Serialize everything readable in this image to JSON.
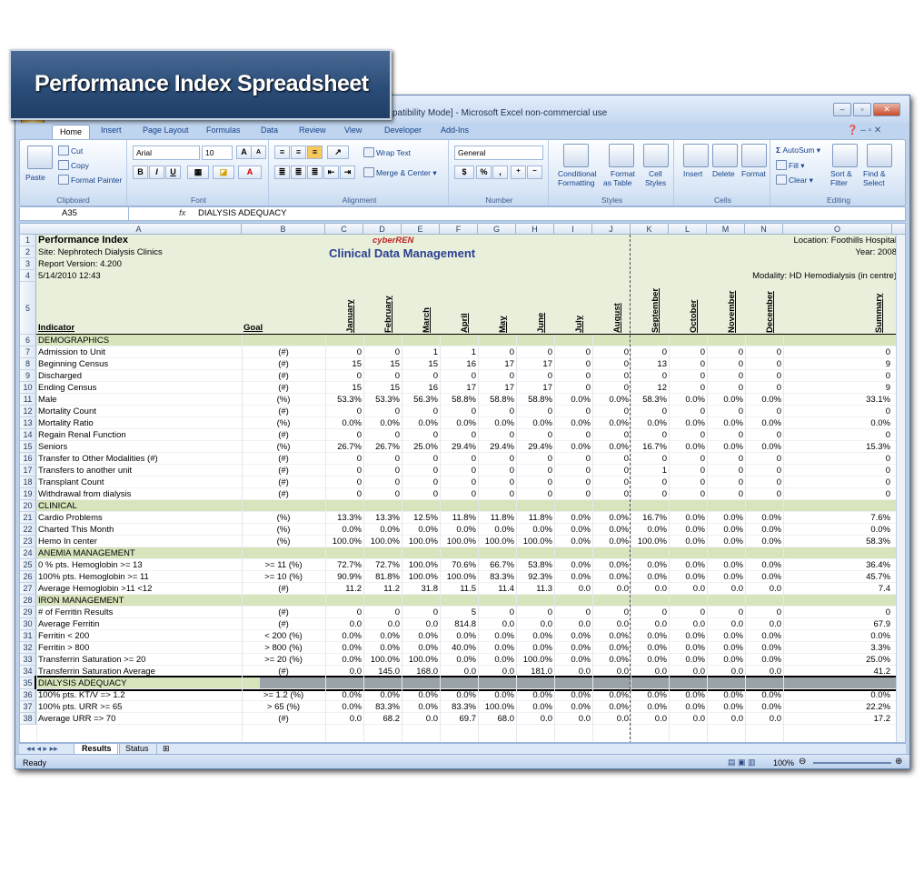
{
  "banner": {
    "title": "Performance Index Spreadsheet"
  },
  "window": {
    "title": "patibility Mode] - Microsoft Excel non-commercial use"
  },
  "tabs": [
    "Home",
    "Insert",
    "Page Layout",
    "Formulas",
    "Data",
    "Review",
    "View",
    "Developer",
    "Add-Ins"
  ],
  "ribbon": {
    "clipboard": {
      "paste": "Paste",
      "cut": "Cut",
      "copy": "Copy",
      "format_painter": "Format Painter",
      "label": "Clipboard"
    },
    "font": {
      "name": "Arial",
      "size": "10",
      "label": "Font",
      "bold": "B",
      "italic": "I",
      "underline": "U",
      "grow": "A",
      "shrink": "A"
    },
    "alignment": {
      "wrap": "Wrap Text",
      "merge": "Merge & Center",
      "label": "Alignment"
    },
    "number": {
      "format": "General",
      "currency": "$",
      "percent": "%",
      "comma": ",",
      "label": "Number"
    },
    "styles": {
      "cond": "Conditional",
      "cond2": "Formatting",
      "fmt_table": "Format",
      "fmt_table2": "as Table",
      "cell_styles": "Cell",
      "cell_styles2": "Styles",
      "label": "Styles"
    },
    "cells": {
      "insert": "Insert",
      "delete": "Delete",
      "format": "Format",
      "label": "Cells"
    },
    "editing": {
      "autosum": "AutoSum",
      "fill": "Fill",
      "clear": "Clear",
      "sort": "Sort &",
      "sort2": "Filter",
      "find": "Find &",
      "find2": "Select",
      "label": "Editing"
    }
  },
  "formula_bar": {
    "name_box": "A35",
    "fx": "fx",
    "content": "DIALYSIS ADEQUACY"
  },
  "columns": [
    "A",
    "B",
    "C",
    "D",
    "E",
    "F",
    "G",
    "H",
    "I",
    "J",
    "K",
    "L",
    "M",
    "N",
    "O"
  ],
  "header": {
    "title": "Performance Index",
    "site": "Site: Nephrotech Dialysis Clinics",
    "version": "Report Version: 4.200",
    "date": "5/14/2010 12:43",
    "logo": "cyberREN",
    "app_title": "Clinical Data Management",
    "location": "Location:  Foothills Hospital",
    "year": "Year:  2008",
    "modality": "Modality:  HD Hemodialysis (in centre)",
    "indicator": "Indicator",
    "goal": "Goal",
    "months": [
      "January",
      "February",
      "March",
      "April",
      "May",
      "June",
      "July",
      "August",
      "September",
      "October",
      "November",
      "December",
      "Summary"
    ]
  },
  "rows": [
    {
      "n": "6",
      "label": "DEMOGRAPHICS",
      "section": true
    },
    {
      "n": "7",
      "label": "Admission to Unit",
      "goal": "(#)",
      "v": [
        "0",
        "0",
        "1",
        "1",
        "0",
        "0",
        "0",
        "0",
        "0",
        "0",
        "0",
        "0",
        "0"
      ]
    },
    {
      "n": "8",
      "label": "Beginning Census",
      "goal": "(#)",
      "v": [
        "15",
        "15",
        "15",
        "16",
        "17",
        "17",
        "0",
        "0",
        "13",
        "0",
        "0",
        "0",
        "9"
      ]
    },
    {
      "n": "9",
      "label": "Discharged",
      "goal": "(#)",
      "v": [
        "0",
        "0",
        "0",
        "0",
        "0",
        "0",
        "0",
        "0",
        "0",
        "0",
        "0",
        "0",
        "0"
      ]
    },
    {
      "n": "10",
      "label": "Ending Census",
      "goal": "(#)",
      "v": [
        "15",
        "15",
        "16",
        "17",
        "17",
        "17",
        "0",
        "0",
        "12",
        "0",
        "0",
        "0",
        "9"
      ]
    },
    {
      "n": "11",
      "label": "Male",
      "goal": "(%)",
      "v": [
        "53.3%",
        "53.3%",
        "56.3%",
        "58.8%",
        "58.8%",
        "58.8%",
        "0.0%",
        "0.0%",
        "58.3%",
        "0.0%",
        "0.0%",
        "0.0%",
        "33.1%"
      ]
    },
    {
      "n": "12",
      "label": "Mortality Count",
      "goal": "(#)",
      "v": [
        "0",
        "0",
        "0",
        "0",
        "0",
        "0",
        "0",
        "0",
        "0",
        "0",
        "0",
        "0",
        "0"
      ]
    },
    {
      "n": "13",
      "label": "Mortality Ratio",
      "goal": "(%)",
      "v": [
        "0.0%",
        "0.0%",
        "0.0%",
        "0.0%",
        "0.0%",
        "0.0%",
        "0.0%",
        "0.0%",
        "0.0%",
        "0.0%",
        "0.0%",
        "0.0%",
        "0.0%"
      ]
    },
    {
      "n": "14",
      "label": "Regain Renal Function",
      "goal": "(#)",
      "v": [
        "0",
        "0",
        "0",
        "0",
        "0",
        "0",
        "0",
        "0",
        "0",
        "0",
        "0",
        "0",
        "0"
      ]
    },
    {
      "n": "15",
      "label": "Seniors",
      "goal": "(%)",
      "v": [
        "26.7%",
        "26.7%",
        "25.0%",
        "29.4%",
        "29.4%",
        "29.4%",
        "0.0%",
        "0.0%",
        "16.7%",
        "0.0%",
        "0.0%",
        "0.0%",
        "15.3%"
      ]
    },
    {
      "n": "16",
      "label": "Transfer to Other Modalities (#)",
      "goal": "(#)",
      "v": [
        "0",
        "0",
        "0",
        "0",
        "0",
        "0",
        "0",
        "0",
        "0",
        "0",
        "0",
        "0",
        "0"
      ]
    },
    {
      "n": "17",
      "label": "Transfers to another unit",
      "goal": "(#)",
      "v": [
        "0",
        "0",
        "0",
        "0",
        "0",
        "0",
        "0",
        "0",
        "1",
        "0",
        "0",
        "0",
        "0"
      ]
    },
    {
      "n": "18",
      "label": "Transplant Count",
      "goal": "(#)",
      "v": [
        "0",
        "0",
        "0",
        "0",
        "0",
        "0",
        "0",
        "0",
        "0",
        "0",
        "0",
        "0",
        "0"
      ]
    },
    {
      "n": "19",
      "label": "Withdrawal from dialysis",
      "goal": "(#)",
      "v": [
        "0",
        "0",
        "0",
        "0",
        "0",
        "0",
        "0",
        "0",
        "0",
        "0",
        "0",
        "0",
        "0"
      ]
    },
    {
      "n": "20",
      "label": "CLINICAL",
      "section": true
    },
    {
      "n": "21",
      "label": "Cardio Problems",
      "goal": "(%)",
      "v": [
        "13.3%",
        "13.3%",
        "12.5%",
        "11.8%",
        "11.8%",
        "11.8%",
        "0.0%",
        "0.0%",
        "16.7%",
        "0.0%",
        "0.0%",
        "0.0%",
        "7.6%"
      ]
    },
    {
      "n": "22",
      "label": "Charted This Month",
      "goal": "(%)",
      "v": [
        "0.0%",
        "0.0%",
        "0.0%",
        "0.0%",
        "0.0%",
        "0.0%",
        "0.0%",
        "0.0%",
        "0.0%",
        "0.0%",
        "0.0%",
        "0.0%",
        "0.0%"
      ]
    },
    {
      "n": "23",
      "label": "Hemo In center",
      "goal": "(%)",
      "v": [
        "100.0%",
        "100.0%",
        "100.0%",
        "100.0%",
        "100.0%",
        "100.0%",
        "0.0%",
        "0.0%",
        "100.0%",
        "0.0%",
        "0.0%",
        "0.0%",
        "58.3%"
      ]
    },
    {
      "n": "24",
      "label": "ANEMIA MANAGEMENT",
      "section": true
    },
    {
      "n": "25",
      "label": "0 % pts. Hemoglobin >= 13",
      "goal": ">= 11 (%)",
      "v": [
        "72.7%",
        "72.7%",
        "100.0%",
        "70.6%",
        "66.7%",
        "53.8%",
        "0.0%",
        "0.0%",
        "0.0%",
        "0.0%",
        "0.0%",
        "0.0%",
        "36.4%"
      ]
    },
    {
      "n": "26",
      "label": "100% pts. Hemoglobin >= 11",
      "goal": ">= 10 (%)",
      "v": [
        "90.9%",
        "81.8%",
        "100.0%",
        "100.0%",
        "83.3%",
        "92.3%",
        "0.0%",
        "0.0%",
        "0.0%",
        "0.0%",
        "0.0%",
        "0.0%",
        "45.7%"
      ]
    },
    {
      "n": "27",
      "label": "Average Hemoglobin >11 <12",
      "goal": "(#)",
      "v": [
        "11.2",
        "11.2",
        "31.8",
        "11.5",
        "11.4",
        "11.3",
        "0.0",
        "0.0",
        "0.0",
        "0.0",
        "0.0",
        "0.0",
        "7.4"
      ]
    },
    {
      "n": "28",
      "label": "IRON MANAGEMENT",
      "section": true
    },
    {
      "n": "29",
      "label": "# of Ferritin Results",
      "goal": "(#)",
      "v": [
        "0",
        "0",
        "0",
        "5",
        "0",
        "0",
        "0",
        "0",
        "0",
        "0",
        "0",
        "0",
        "0"
      ]
    },
    {
      "n": "30",
      "label": "Average Ferritin",
      "goal": "(#)",
      "v": [
        "0.0",
        "0.0",
        "0.0",
        "814.8",
        "0.0",
        "0.0",
        "0.0",
        "0.0",
        "0.0",
        "0.0",
        "0.0",
        "0.0",
        "67.9"
      ]
    },
    {
      "n": "31",
      "label": "Ferritin < 200",
      "goal": "< 200 (%)",
      "v": [
        "0.0%",
        "0.0%",
        "0.0%",
        "0.0%",
        "0.0%",
        "0.0%",
        "0.0%",
        "0.0%",
        "0.0%",
        "0.0%",
        "0.0%",
        "0.0%",
        "0.0%"
      ]
    },
    {
      "n": "32",
      "label": "Ferritin > 800",
      "goal": "> 800 (%)",
      "v": [
        "0.0%",
        "0.0%",
        "0.0%",
        "40.0%",
        "0.0%",
        "0.0%",
        "0.0%",
        "0.0%",
        "0.0%",
        "0.0%",
        "0.0%",
        "0.0%",
        "3.3%"
      ]
    },
    {
      "n": "33",
      "label": "Transferrin Saturation >= 20",
      "goal": ">= 20 (%)",
      "v": [
        "0.0%",
        "100.0%",
        "100.0%",
        "0.0%",
        "0.0%",
        "100.0%",
        "0.0%",
        "0.0%",
        "0.0%",
        "0.0%",
        "0.0%",
        "0.0%",
        "25.0%"
      ]
    },
    {
      "n": "34",
      "label": "Transferrin Saturation Average",
      "goal": "(#)",
      "v": [
        "0.0",
        "145.0",
        "168.0",
        "0.0",
        "0.0",
        "181.0",
        "0.0",
        "0.0",
        "0.0",
        "0.0",
        "0.0",
        "0.0",
        "41.2"
      ]
    },
    {
      "n": "35",
      "label": "DIALYSIS ADEQUACY",
      "section": true,
      "selected": true
    },
    {
      "n": "36",
      "label": "100% pts. KT/V  => 1.2",
      "goal": ">= 1.2 (%)",
      "v": [
        "0.0%",
        "0.0%",
        "0.0%",
        "0.0%",
        "0.0%",
        "0.0%",
        "0.0%",
        "0.0%",
        "0.0%",
        "0.0%",
        "0.0%",
        "0.0%",
        "0.0%"
      ]
    },
    {
      "n": "37",
      "label": "100% pts. URR >= 65",
      "goal": "> 65 (%)",
      "v": [
        "0.0%",
        "83.3%",
        "0.0%",
        "83.3%",
        "100.0%",
        "0.0%",
        "0.0%",
        "0.0%",
        "0.0%",
        "0.0%",
        "0.0%",
        "0.0%",
        "22.2%"
      ]
    },
    {
      "n": "38",
      "label": "Average URR => 70",
      "goal": "(#)",
      "v": [
        "0.0",
        "68.2",
        "0.0",
        "69.7",
        "68.0",
        "0.0",
        "0.0",
        "0.0",
        "0.0",
        "0.0",
        "0.0",
        "0.0",
        "17.2"
      ]
    }
  ],
  "sheet_tabs": [
    "Results",
    "Status"
  ],
  "status": {
    "ready": "Ready",
    "zoom": "100%"
  }
}
